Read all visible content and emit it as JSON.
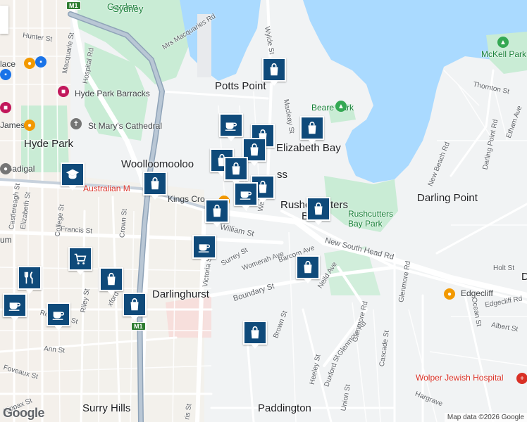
{
  "map": {
    "colors": {
      "water": "#aadaff",
      "park": "#c9ecd5",
      "road": "#ffffff",
      "highway": "#a9b8c7",
      "marker": "#0f4a7a",
      "orange_pin": "#f29900",
      "hospital": "#d93025"
    },
    "suburbs": {
      "potts_point": "Potts Point",
      "elizabeth_bay": "Elizabeth Bay",
      "woolloomooloo": "Woolloomooloo",
      "rushcutters_bay": "Rushcutters Bay",
      "darling_point": "Darling Point",
      "darlinghurst": "Darlinghurst",
      "surry_hills": "Surry Hills",
      "paddington": "Paddington",
      "kings_cross": "Kings Cross",
      "edgecliff": "Edgecliff",
      "hyde_park": "Hyde Park",
      "sydney": "Sydney",
      "garden": "Garden"
    },
    "places": {
      "hyde_park_barracks": "Hyde Park Barracks",
      "st_marys": "St Mary's Cathedral",
      "beare_park": "Beare Park",
      "rushcutters_bay_park": "Rushcutters Bay Park",
      "mckell_park": "McKell Park",
      "wolper": "Wolper Jewish Hospital",
      "australian_museum": "Australian M",
      "gadigal": "Gadigal",
      "james": "James",
      "place": "lace",
      "um": "um"
    },
    "streets": {
      "hunter": "Hunter St",
      "macquarie": "Macquarie St",
      "hospital_rd": "Hospital Rd",
      "mrs_macquaries": "Mrs Macquaries Rd",
      "wylde": "Wylde St",
      "macleay": "Macleay St",
      "thornton": "Thornton St",
      "new_beach": "New Beach Rd",
      "darling_point_rd": "Darling Point Rd",
      "etham": "Etham Ave",
      "william": "William St",
      "francis": "Francis St",
      "crown": "Crown St",
      "college": "College St",
      "elizabeth": "Elizabeth St",
      "castlereagh": "Castlereagh St",
      "victoria": "Victoria St",
      "surrey": "Surrey St",
      "womerah": "Womerah Ave",
      "barcom": "Barcom Ave",
      "new_south_head": "New South Head Rd",
      "neild": "Neild Ave",
      "boundary": "Boundary St",
      "brown": "Brown St",
      "glenmore_rd": "Glenmore Rd",
      "glenmore_rd2": "Glenmore Rd",
      "holt": "Holt St",
      "ocean": "Ocean St",
      "albert": "Albert St",
      "edgecliff_rd": "Edgecliff Rd",
      "cascade": "Cascade St",
      "heeley": "Heeley St",
      "duxford": "Duxford St",
      "union": "Union St",
      "hargrave": "Hargrave",
      "riley": "Riley St",
      "reservoir": "Reservoir St",
      "ann": "Ann St",
      "foveaux": "Foveaux St",
      "kippax": "Kippax St",
      "oxford": "xford",
      "harris": "ris St",
      "wa": "Wa",
      "kings_cross_short": "Kings Cro",
      "ss": "ss",
      "rushcutters_short": "Rushc",
      "ters": "ters",
      "b": "B",
      "d": "D",
      "m1": "M1"
    },
    "markers": [
      {
        "type": "shopping",
        "name": "marker-shopping-potts-point"
      },
      {
        "type": "cafe",
        "name": "marker-cafe-1"
      },
      {
        "type": "shopping",
        "name": "marker-shopping-2"
      },
      {
        "type": "shopping",
        "name": "marker-shopping-3"
      },
      {
        "type": "shopping",
        "name": "marker-shopping-4"
      },
      {
        "type": "shopping",
        "name": "marker-shopping-5"
      },
      {
        "type": "shopping",
        "name": "marker-shopping-6"
      },
      {
        "type": "cafe",
        "name": "marker-cafe-2"
      },
      {
        "type": "shopping",
        "name": "marker-shopping-elizabeth-bay"
      },
      {
        "type": "shopping",
        "name": "marker-shopping-woolloomooloo"
      },
      {
        "type": "shopping",
        "name": "marker-shopping-kings-cross"
      },
      {
        "type": "shopping",
        "name": "marker-shopping-rushcutters"
      },
      {
        "type": "cafe",
        "name": "marker-cafe-victoria"
      },
      {
        "type": "shopping",
        "name": "marker-shopping-neild"
      },
      {
        "type": "university",
        "name": "marker-university"
      },
      {
        "type": "grocery",
        "name": "marker-grocery"
      },
      {
        "type": "restaurant",
        "name": "marker-restaurant"
      },
      {
        "type": "shopping",
        "name": "marker-shopping-darlinghurst-1"
      },
      {
        "type": "shopping",
        "name": "marker-shopping-darlinghurst-2"
      },
      {
        "type": "cafe",
        "name": "marker-cafe-surry-1"
      },
      {
        "type": "cafe",
        "name": "marker-cafe-surry-2"
      },
      {
        "type": "shopping",
        "name": "marker-shopping-paddington"
      }
    ],
    "attribution": "Map data ©2026 Google",
    "logo": "Google"
  }
}
